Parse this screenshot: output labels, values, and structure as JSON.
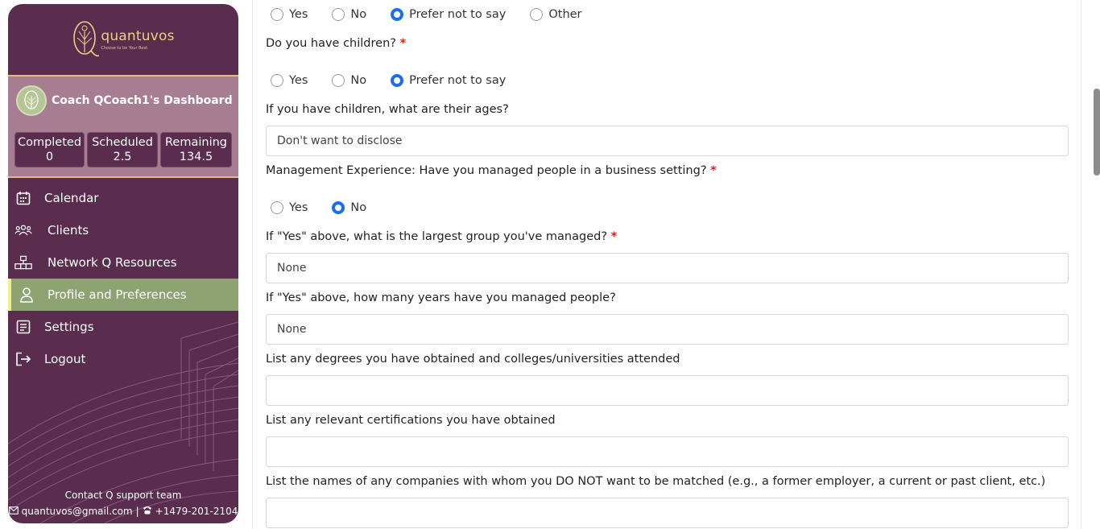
{
  "sidebar": {
    "logo": {
      "name": "quantuvos",
      "tagline": "Choose to be Your Best"
    },
    "coach_name": "Coach QCoach1's Dashboard",
    "stats": [
      {
        "label": "Completed",
        "value": "0"
      },
      {
        "label": "Scheduled",
        "value": "2.5"
      },
      {
        "label": "Remaining",
        "value": "134.5"
      }
    ],
    "nav": [
      {
        "label": "Calendar",
        "icon": "calendar-icon"
      },
      {
        "label": "Clients",
        "icon": "users-icon"
      },
      {
        "label": "Network Q Resources",
        "icon": "network-icon"
      },
      {
        "label": "Profile and Preferences",
        "icon": "user-icon",
        "active": true
      },
      {
        "label": "Settings",
        "icon": "settings-icon"
      },
      {
        "label": "Logout",
        "icon": "logout-icon"
      }
    ],
    "support": {
      "title": "Contact Q support team",
      "email": "quantuvos@gmail.com",
      "separator": "|",
      "phone": "+1479-201-2104"
    }
  },
  "form": {
    "q0_options": [
      "Yes",
      "No",
      "Prefer not to say",
      "Other"
    ],
    "q0_selected": "Prefer not to say",
    "children": {
      "question": "Do you have children?",
      "required": "*",
      "options": [
        "Yes",
        "No",
        "Prefer not to say"
      ],
      "selected": "Prefer not to say"
    },
    "children_ages": {
      "question": "If you have children, what are their ages?",
      "value": "Don't want to disclose"
    },
    "management": {
      "question": "Management Experience: Have you managed people in a business setting?",
      "required": "*",
      "options": [
        "Yes",
        "No"
      ],
      "selected": "No"
    },
    "largest_group": {
      "question": "If \"Yes\" above, what is the largest group you've managed?",
      "required": "*",
      "value": "None"
    },
    "years_managed": {
      "question": "If \"Yes\" above, how many years have you managed people?",
      "value": "None"
    },
    "degrees": {
      "question": "List any degrees you have obtained and colleges/universities attended",
      "value": ""
    },
    "certifications": {
      "question": "List any relevant certifications you have obtained",
      "value": ""
    },
    "companies": {
      "question": "List the names of any companies with whom you DO NOT want to be matched (e.g., a former employer, a current or past client, etc.)",
      "value": ""
    }
  },
  "colors": {
    "sidebar_bg": "#5a2d4f",
    "profile_bg": "#a77e91",
    "active_nav": "#8da372",
    "accent_gold": "#e8d184",
    "radio_selected": "#1a6ff0",
    "required": "#e02020"
  }
}
